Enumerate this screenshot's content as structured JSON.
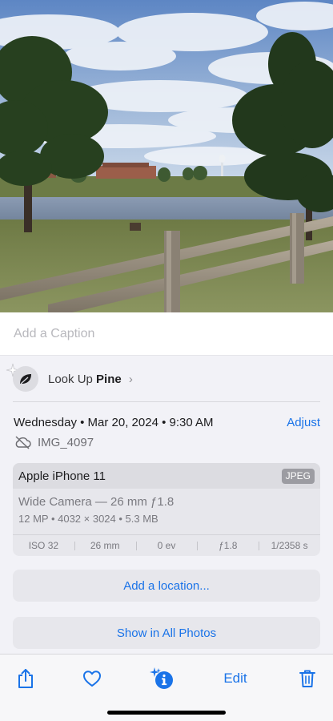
{
  "photo": {
    "subject": "lake-with-pine-trees-and-split-rail-fence"
  },
  "caption": {
    "placeholder": "Add a Caption"
  },
  "lookup": {
    "prefix": "Look Up",
    "subject": "Pine",
    "chevron": "›",
    "icon": "leaf-icon"
  },
  "metadata": {
    "date": "Wednesday • Mar 20, 2024 • 9:30 AM",
    "adjust_label": "Adjust",
    "file_name": "IMG_4097",
    "cloud_icon": "cloud-slash-icon"
  },
  "camera": {
    "device": "Apple iPhone 11",
    "format": "JPEG",
    "lens": "Wide Camera — 26 mm ƒ1.8",
    "specs": "12 MP  •  4032 × 3024  •  5.3 MB",
    "exif": [
      "ISO 32",
      "26 mm",
      "0 ev",
      "ƒ1.8",
      "1/2358 s"
    ]
  },
  "actions": {
    "add_location": "Add a location...",
    "show_in_all_photos": "Show in All Photos"
  },
  "toolbar": {
    "share_icon": "share-icon",
    "favorite_icon": "heart-icon",
    "info_icon": "info-sparkle-icon",
    "edit_label": "Edit",
    "delete_icon": "trash-icon"
  },
  "colors": {
    "accent": "#1a73e8",
    "panel_bg": "#f2f2f7",
    "card_bg": "#e7e7ec"
  }
}
